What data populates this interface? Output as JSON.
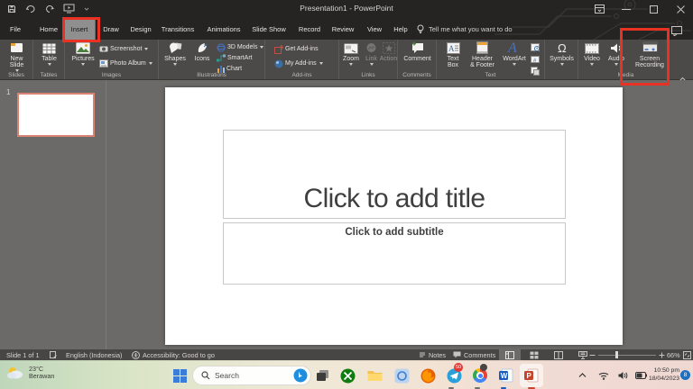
{
  "titlebar": {
    "title": "Presentation1 - PowerPoint"
  },
  "tabs": {
    "items": [
      "File",
      "Home",
      "Insert",
      "Draw",
      "Design",
      "Transitions",
      "Animations",
      "Slide Show",
      "Record",
      "Review",
      "View",
      "Help"
    ],
    "tell_me": "Tell me what you want to do"
  },
  "ribbon": {
    "slides": {
      "label": "Slides",
      "new_slide": "New Slide"
    },
    "tables": {
      "label": "Tables",
      "table": "Table"
    },
    "images": {
      "label": "Images",
      "pictures": "Pictures",
      "screenshot": "Screenshot",
      "photo_album": "Photo Album"
    },
    "illustrations": {
      "label": "Illustrations",
      "shapes": "Shapes",
      "icons": "Icons",
      "models_3d": "3D Models",
      "smartart": "SmartArt",
      "chart": "Chart"
    },
    "addins": {
      "label": "Add-ins",
      "get_addins": "Get Add-ins",
      "my_addins": "My Add-ins"
    },
    "links": {
      "label": "Links",
      "zoom": "Zoom",
      "link": "Link",
      "action": "Action"
    },
    "comments": {
      "label": "Comments",
      "comment": "Comment"
    },
    "text": {
      "label": "Text",
      "text_box": "Text Box",
      "header_footer": "Header\n& Footer",
      "wordart": "WordArt"
    },
    "symbols": {
      "symbols": "Symbols"
    },
    "media": {
      "label": "Media",
      "video": "Video",
      "audio": "Audio",
      "screen_recording": "Screen Recording"
    }
  },
  "slide": {
    "number": "1",
    "title_placeholder": "Click to add title",
    "subtitle_placeholder": "Click to add subtitle"
  },
  "statusbar": {
    "slide": "Slide 1 of 1",
    "language": "English (Indonesia)",
    "accessibility": "Accessibility: Good to go",
    "notes": "Notes",
    "comments": "Comments",
    "zoom": "66%"
  },
  "taskbar": {
    "weather_temp": "23°C",
    "weather_desc": "Berawan",
    "search": "Search",
    "telegram_badge": "50",
    "time": "10:50 pm",
    "date": "18/04/2023",
    "badge": "8"
  }
}
